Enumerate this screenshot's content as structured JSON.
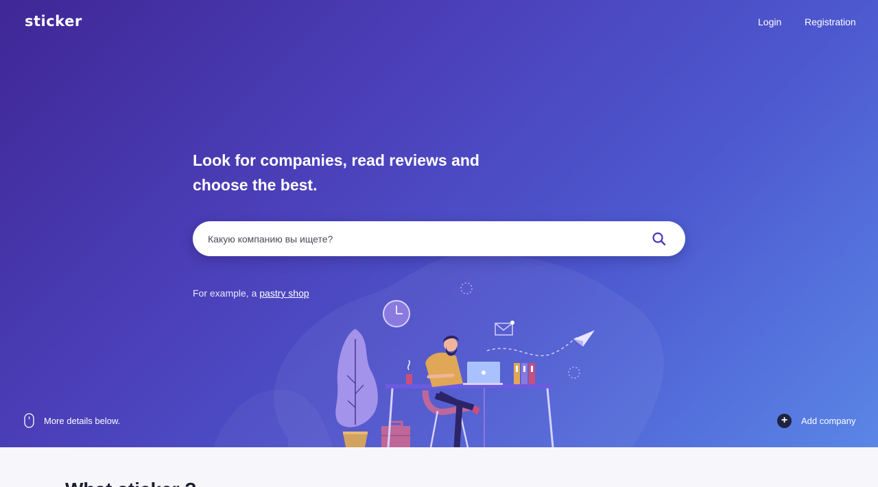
{
  "header": {
    "logo": "sticker",
    "login": "Login",
    "registration": "Registration"
  },
  "hero": {
    "headline": "Look for companies, read reviews and choose the best.",
    "search_placeholder": "Какую компанию вы ищете?",
    "example_prefix": "For example, a",
    "example_link": "pastry shop",
    "more_details": "More details below.",
    "add_company": "Add company"
  },
  "next_section": {
    "title": "What sticker ?"
  },
  "colors": {
    "gradient_start": "#3f2796",
    "gradient_end": "#5a86e6",
    "accent": "#4a2fbf",
    "section_bg": "#f6f6fb"
  },
  "icons": {
    "search": "search-icon",
    "mouse": "mouse-icon",
    "add": "plus-icon"
  }
}
